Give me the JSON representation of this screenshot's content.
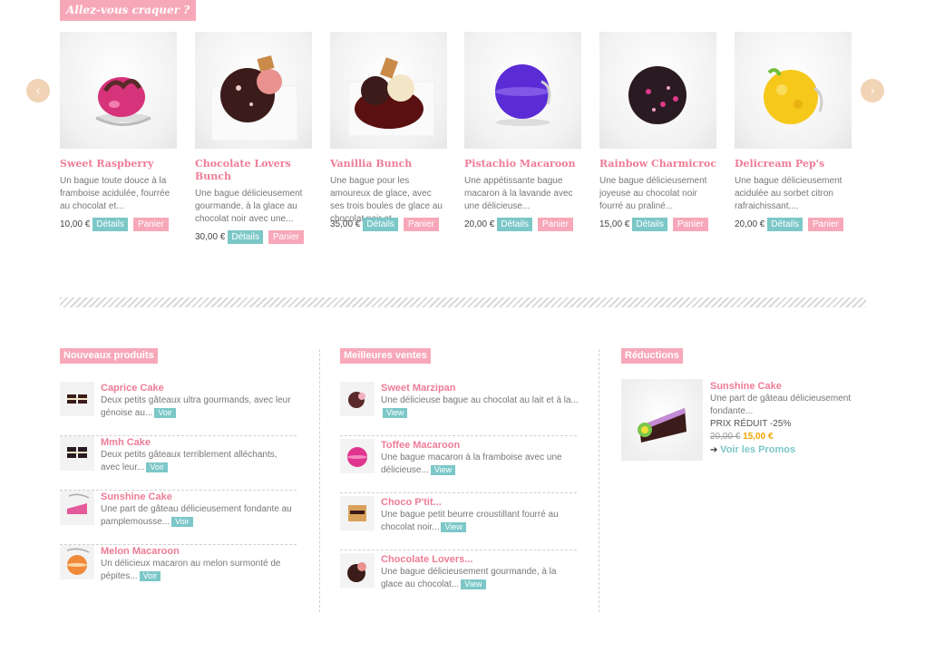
{
  "header": {
    "title": "Allez-vous craquer ?"
  },
  "carousel": {
    "prev_icon": "‹",
    "next_icon": "›",
    "details_label": "Détails",
    "panier_label": "Panier",
    "products": [
      {
        "title": "Sweet Raspberry",
        "desc": "Un bague toute douce à la framboise acidulée, fourrée au chocolat et...",
        "price": "10,00 €"
      },
      {
        "title": "Chocolate Lovers Bunch",
        "desc": "Une bague délicieusement gourmande, à la glace au chocolat noir avec une...",
        "price": "30,00 €"
      },
      {
        "title": "Vanillia Bunch",
        "desc": "Une bague pour les amoureux de glace, avec ses trois boules de glace au chocolat noir et...",
        "price": "35,00 €"
      },
      {
        "title": "Pistachio Macaroon",
        "desc": "Une appétissante bague macaron à la lavande avec une délicieuse...",
        "price": "20,00 €"
      },
      {
        "title": "Rainbow Charmicroc",
        "desc": "Une bague délicieusement joyeuse au chocolat noir fourré au praliné...",
        "price": "15,00 €"
      },
      {
        "title": "Delicream Pep's",
        "desc": "Une bague délicieusement acidulée au sorbet citron rafraichissant....",
        "price": "20,00 €"
      }
    ]
  },
  "nouveaux": {
    "title": "Nouveaux produits",
    "voir_label": "Voir",
    "items": [
      {
        "title": "Caprice Cake",
        "desc": "Deux petits gâteaux ultra gourmands, avec leur génoise au..."
      },
      {
        "title": "Mmh Cake",
        "desc": "Deux petits gâteaux terriblement alléchants, avec leur..."
      },
      {
        "title": "Sunshine Cake",
        "desc": "Une part de gâteau délicieusement fondante au pamplemousse..."
      },
      {
        "title": "Melon Macaroon",
        "desc": "Un délicieux macaron au melon surmonté de pépites..."
      }
    ]
  },
  "meilleures": {
    "title": "Meilleures ventes",
    "view_label": "View",
    "items": [
      {
        "title": "Sweet Marzipan",
        "desc": "Une délicieuse bague au chocolat au lait et à la..."
      },
      {
        "title": "Toffee Macaroon",
        "desc": "Une bague macaron à la framboise avec une délicieuse..."
      },
      {
        "title": "Choco P'tit...",
        "desc": "Une bague petit beurre croustillant fourré au chocolat noir..."
      },
      {
        "title": "Chocolate Lovers...",
        "desc": "Une bague délicieusement gourmande, à la glace au chocolat..."
      }
    ]
  },
  "reductions": {
    "title": "Réductions",
    "item_title": "Sunshine Cake",
    "item_desc": "Une part de gâteau délicieusement fondante...",
    "discount": "PRIX RÉDUIT -25%",
    "old_price": "20,00 €",
    "new_price": "15,00 €",
    "arrow": "➔",
    "voir_promos": "Voir les Promos"
  },
  "colors": {
    "pink": "#f7a8b8",
    "title_pink": "#ee7c96",
    "teal": "#7cc7c8",
    "arrow_bg": "#f1d3b6",
    "price_orange": "#f0a300"
  }
}
